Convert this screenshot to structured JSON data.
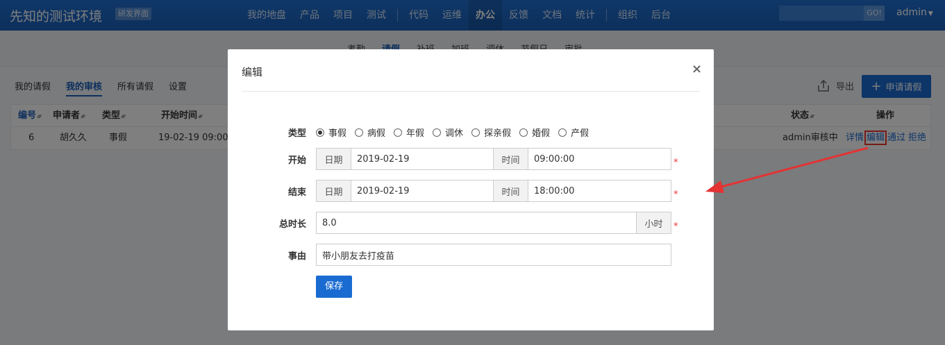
{
  "topbar": {
    "brand": "先知的测试环境",
    "env_tag": "研发界面",
    "nav": [
      "我的地盘",
      "产品",
      "项目",
      "测试",
      "|",
      "代码",
      "运维",
      "办公",
      "反馈",
      "文档",
      "统计",
      "|",
      "组织",
      "后台"
    ],
    "active_nav": "办公",
    "search_button": "GO!",
    "user": "admin"
  },
  "subnav": {
    "items": [
      "考勤",
      "请假",
      "补班",
      "加班",
      "调休",
      "节假日",
      "审批"
    ],
    "active": "请假"
  },
  "tabs": {
    "items": [
      "我的请假",
      "我的审核",
      "所有请假",
      "设置"
    ],
    "active": "我的审核"
  },
  "toolbar": {
    "export_label": "导出",
    "apply_label": "申请请假"
  },
  "table": {
    "headers": {
      "id": "编号",
      "applicant": "申请者",
      "type": "类型",
      "start": "开始时间",
      "status": "状态",
      "actions": "操作"
    },
    "row": {
      "id": "6",
      "applicant": "胡久久",
      "type": "事假",
      "start": "19-02-19 09:00",
      "status": "admin审核中",
      "actions": [
        "详情",
        "编辑",
        "通过",
        "拒绝"
      ]
    }
  },
  "modal": {
    "title": "编辑",
    "close": "×",
    "labels": {
      "type": "类型",
      "start": "开始",
      "end": "结束",
      "hours": "总时长",
      "reason": "事由"
    },
    "type_options": [
      "事假",
      "病假",
      "年假",
      "调休",
      "探亲假",
      "婚假",
      "产假"
    ],
    "selected_type": "事假",
    "start": {
      "date_label": "日期",
      "date": "2019-02-19",
      "time_label": "时间",
      "time": "09:00:00"
    },
    "end": {
      "date_label": "日期",
      "date": "2019-02-19",
      "time_label": "时间",
      "time": "18:00:00"
    },
    "hours": {
      "value": "8.0",
      "unit": "小时"
    },
    "reason": "带小朋友去打疫苗",
    "required_mark": "*",
    "save_label": "保存"
  },
  "colors": {
    "brand_blue": "#1a6bd1",
    "required_red": "#e33333",
    "annotation_red": "#e33333"
  }
}
